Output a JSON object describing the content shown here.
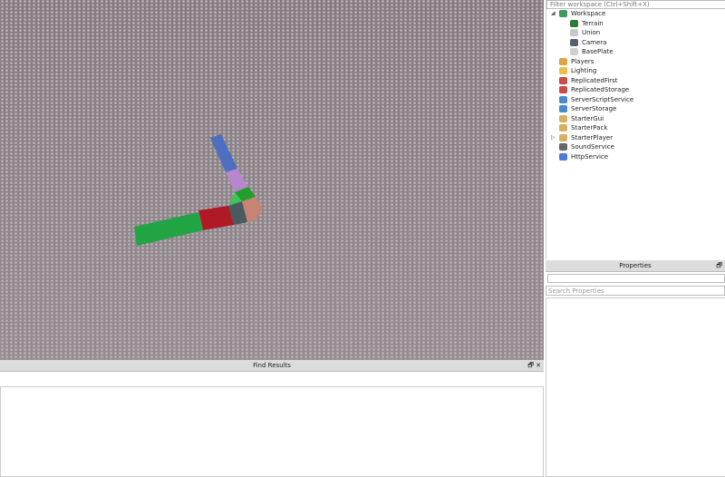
{
  "explorer": {
    "filter_placeholder": "Filter workspace (Ctrl+Shift+X)",
    "items": [
      {
        "label": "Workspace",
        "icon": "workspace-icon",
        "color": "#3a9b5c",
        "depth": 0,
        "expanded": true
      },
      {
        "label": "Terrain",
        "icon": "terrain-icon",
        "color": "#2e7a3a",
        "depth": 1
      },
      {
        "label": "Union",
        "icon": "union-icon",
        "color": "#c8c8c8",
        "depth": 1
      },
      {
        "label": "Camera",
        "icon": "camera-icon",
        "color": "#556070",
        "depth": 1
      },
      {
        "label": "BasePlate",
        "icon": "part-icon",
        "color": "#d0d0d0",
        "depth": 1
      },
      {
        "label": "Players",
        "icon": "players-icon",
        "color": "#d9a441",
        "depth": 0
      },
      {
        "label": "Lighting",
        "icon": "lighting-icon",
        "color": "#e6c04a",
        "depth": 0
      },
      {
        "label": "ReplicatedFirst",
        "icon": "replicated-first-icon",
        "color": "#c94a4a",
        "depth": 0
      },
      {
        "label": "ReplicatedStorage",
        "icon": "replicated-storage-icon",
        "color": "#c94a4a",
        "depth": 0
      },
      {
        "label": "ServerScriptService",
        "icon": "server-script-service-icon",
        "color": "#4a8ac9",
        "depth": 0
      },
      {
        "label": "ServerStorage",
        "icon": "server-storage-icon",
        "color": "#4a8ac9",
        "depth": 0
      },
      {
        "label": "StarterGui",
        "icon": "starter-gui-icon",
        "color": "#d9b060",
        "depth": 0
      },
      {
        "label": "StarterPack",
        "icon": "starter-pack-icon",
        "color": "#d9b060",
        "depth": 0
      },
      {
        "label": "StarterPlayer",
        "icon": "starter-player-icon",
        "color": "#d9b060",
        "depth": 0,
        "collapsed": true
      },
      {
        "label": "SoundService",
        "icon": "sound-service-icon",
        "color": "#666666",
        "depth": 0
      },
      {
        "label": "HttpService",
        "icon": "http-service-icon",
        "color": "#4a7ad9",
        "depth": 0
      }
    ]
  },
  "properties": {
    "title": "Properties",
    "search_placeholder": "Search Properties"
  },
  "find_results": {
    "title": "Find Results"
  },
  "controls": {
    "float": "🗗",
    "close": "✕"
  }
}
